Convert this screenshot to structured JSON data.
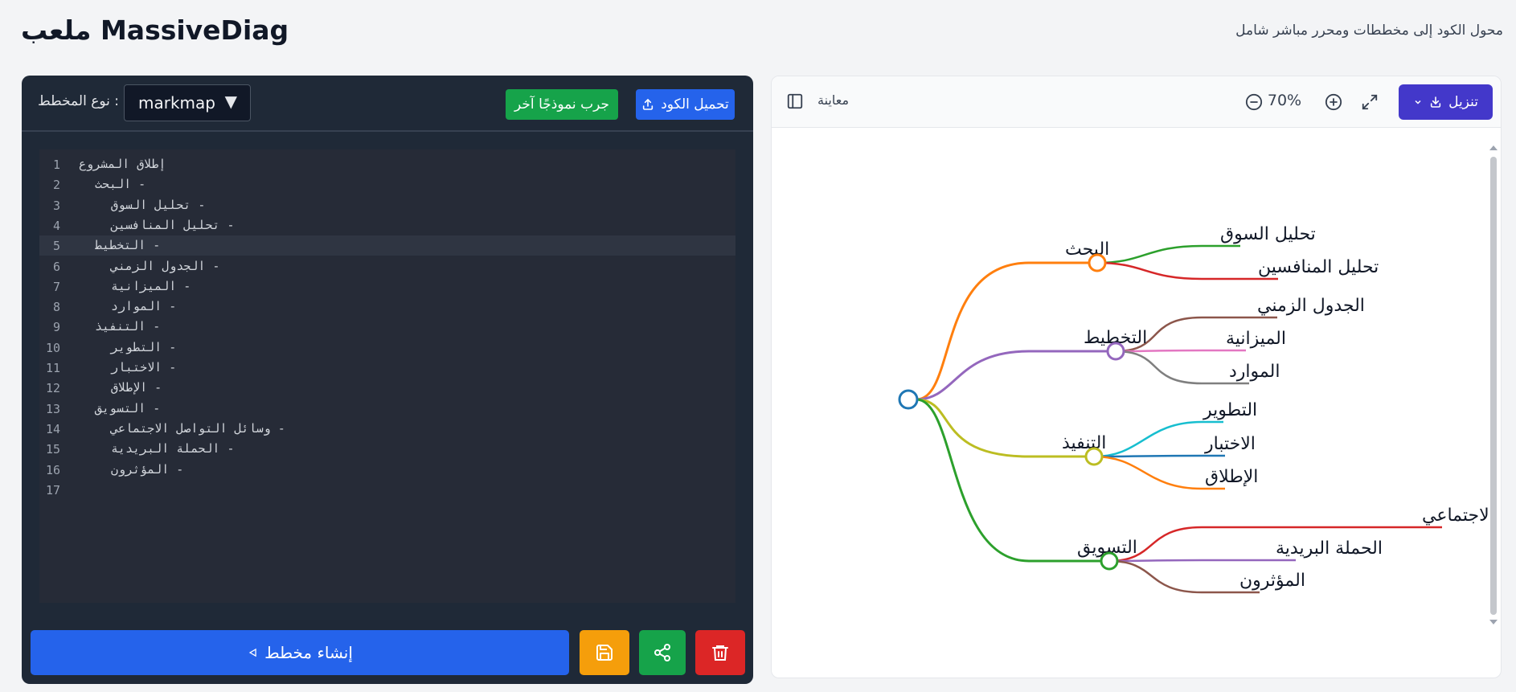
{
  "header": {
    "title": "ملعب MassiveDiag",
    "subtitle": "محول الكود إلى مخططات ومحرر مباشر شامل"
  },
  "editor": {
    "diagram_type_label": ": نوع المخطط",
    "diagram_type_value": "markmap",
    "try_example_label": "جرب نموذجًا آخر",
    "upload_label": "تحميل الكود",
    "generate_label": "إنشاء مخطط",
    "active_line": 5,
    "lines": [
      {
        "n": "1",
        "text": "إطلاق المشروع",
        "indent": 0
      },
      {
        "n": "2",
        "text": "- البحث",
        "indent": 1
      },
      {
        "n": "3",
        "text": "- تحليل السوق",
        "indent": 2
      },
      {
        "n": "4",
        "text": "- تحليل المنافسين",
        "indent": 2
      },
      {
        "n": "5",
        "text": "- التخطيط",
        "indent": 1
      },
      {
        "n": "6",
        "text": "- الجدول الزمني",
        "indent": 2
      },
      {
        "n": "7",
        "text": "- الميزانية",
        "indent": 2
      },
      {
        "n": "8",
        "text": "- الموارد",
        "indent": 2
      },
      {
        "n": "9",
        "text": "- التنفيذ",
        "indent": 1
      },
      {
        "n": "10",
        "text": "- التطوير",
        "indent": 2
      },
      {
        "n": "11",
        "text": "- الاختبار",
        "indent": 2
      },
      {
        "n": "12",
        "text": "- الإطلاق",
        "indent": 2
      },
      {
        "n": "13",
        "text": "- التسويق",
        "indent": 1
      },
      {
        "n": "14",
        "text": "- وسائل التواصل الاجتماعي",
        "indent": 2
      },
      {
        "n": "15",
        "text": "- الحملة البريدية",
        "indent": 2
      },
      {
        "n": "16",
        "text": "- المؤثرون",
        "indent": 2
      },
      {
        "n": "17",
        "text": "",
        "indent": 0
      }
    ]
  },
  "preview": {
    "label": "معاينة",
    "zoom": "70%",
    "download_label": "تنزيل"
  },
  "mindmap": {
    "root_color": "#1f77b4",
    "branches": [
      {
        "label": "البحث",
        "color": "#ff7f0e",
        "children": [
          {
            "label": "تحليل السوق",
            "color": "#2ca02c"
          },
          {
            "label": "تحليل المنافسين",
            "color": "#d62728"
          }
        ]
      },
      {
        "label": "التخطيط",
        "color": "#9467bd",
        "children": [
          {
            "label": "الجدول الزمني",
            "color": "#8c564b"
          },
          {
            "label": "الميزانية",
            "color": "#e377c2"
          },
          {
            "label": "الموارد",
            "color": "#7f7f7f"
          }
        ]
      },
      {
        "label": "التنفيذ",
        "color": "#bcbd22",
        "children": [
          {
            "label": "التطوير",
            "color": "#17becf"
          },
          {
            "label": "الاختبار",
            "color": "#1f77b4"
          },
          {
            "label": "الإطلاق",
            "color": "#ff7f0e"
          }
        ]
      },
      {
        "label": "التسويق",
        "color": "#2ca02c",
        "children": [
          {
            "label": "وسائل التواصل الاجتماعي",
            "color": "#d62728"
          },
          {
            "label": "الحملة البريدية",
            "color": "#9467bd"
          },
          {
            "label": "المؤثرون",
            "color": "#8c564b"
          }
        ]
      }
    ]
  }
}
